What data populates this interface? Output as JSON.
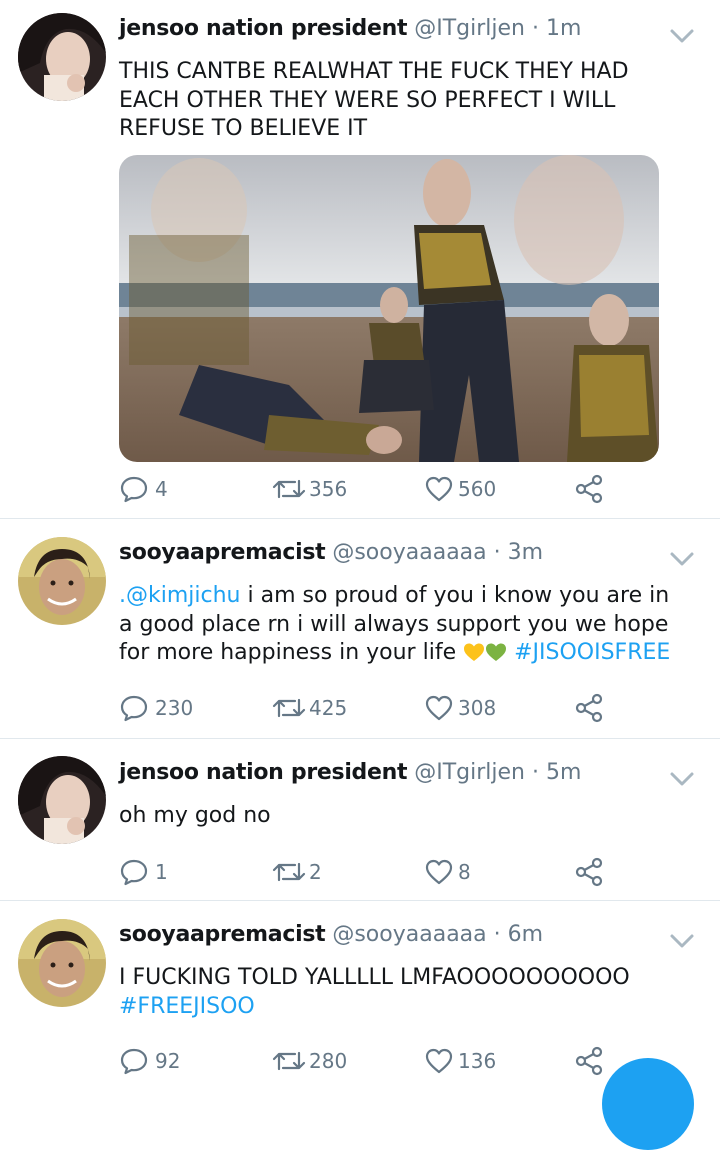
{
  "tweets": [
    {
      "name": "jensoo nation president",
      "handle": "@ITgirljen",
      "sep": "·",
      "time": "1m",
      "text": "THIS CANTBE REALWHAT THE FUCK THEY HAD EACH OTHER THEY WERE SO PERFECT I WILL REFUSE TO BELIEVE IT",
      "replies": "4",
      "retweets": "356",
      "likes": "560"
    },
    {
      "name": "sooyaapremacist",
      "handle": "@sooyaaaaaa",
      "sep": "·",
      "time": "3m",
      "mention": ".@kimjichu",
      "text": " i am so proud of you i know you are in a good place rn i will always support you we hope for more happiness in your life ",
      "hashtag": "#JISOOISFREE",
      "replies": "230",
      "retweets": "425",
      "likes": "308"
    },
    {
      "name": "jensoo nation president",
      "handle": "@ITgirljen",
      "sep": "·",
      "time": "5m",
      "text": "oh my god no",
      "replies": "1",
      "retweets": "2",
      "likes": "8"
    },
    {
      "name": "sooyaapremacist",
      "handle": "@sooyaaaaaa",
      "sep": "·",
      "time": "6m",
      "text": "I FUCKING TOLD YALLLLL LMFAOOOOOOOOOO",
      "hashtag": "#FREEJISOO",
      "replies": "92",
      "retweets": "280",
      "likes": "136"
    }
  ],
  "icons": {
    "reply": "reply-icon",
    "retweet": "retweet-icon",
    "like": "heart-icon",
    "share": "share-icon",
    "caret": "chevron-down-icon"
  },
  "colors": {
    "accent": "#1da1f2",
    "muted": "#657786",
    "text": "#14171a",
    "divider": "#e1e8ed"
  }
}
